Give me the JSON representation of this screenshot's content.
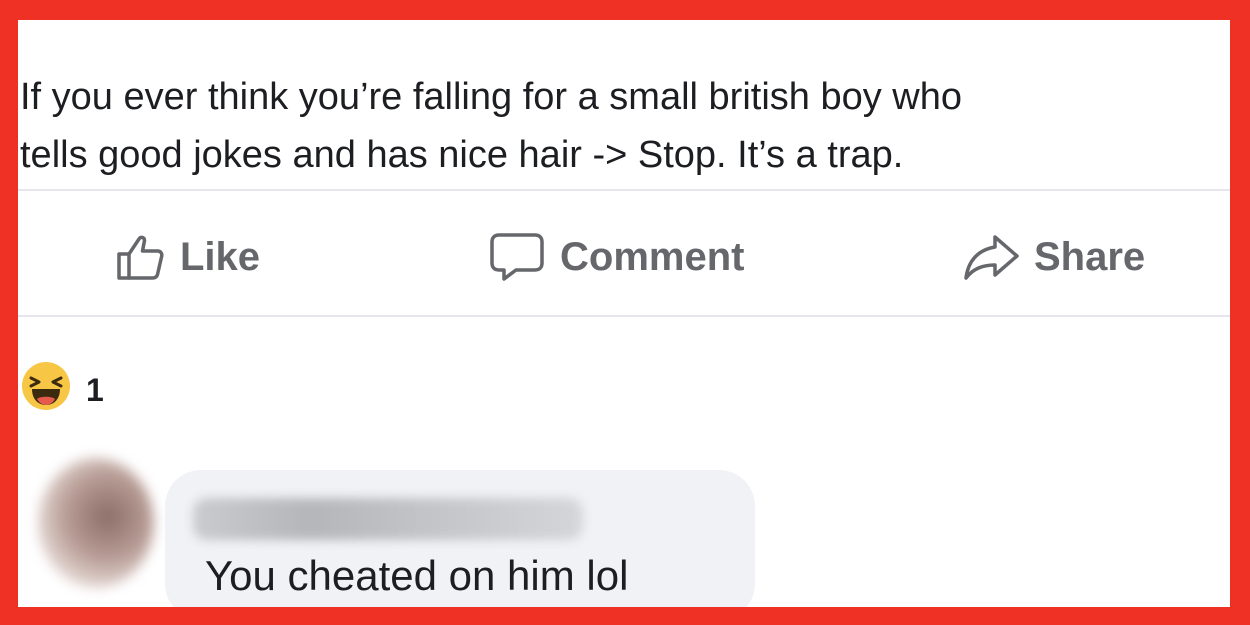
{
  "post": {
    "text": "If you ever think you’re falling for a small british boy who\ntells good jokes and has nice hair -> Stop. It’s a trap."
  },
  "actions": {
    "like_label": "Like",
    "comment_label": "Comment",
    "share_label": "Share"
  },
  "reactions": {
    "icon": "laughing-emoji-icon",
    "count": "1"
  },
  "comment": {
    "author_blurred": true,
    "text": "You cheated on him lol"
  },
  "colors": {
    "frame": "#ee3124",
    "action_text": "#65676b",
    "bubble": "#f0f2f5"
  }
}
